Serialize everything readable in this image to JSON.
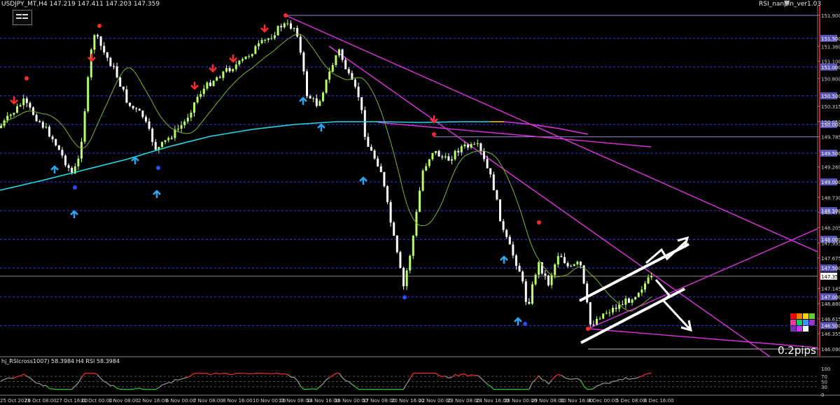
{
  "header": {
    "symbol_info": "USDJPY_MT,H4  147.219 147.411 147.203 147.359",
    "indicator_name": "RSI_nanpin_ver1.03"
  },
  "price_axis": {
    "labels": [
      "151.900",
      "151.360",
      "151.100",
      "150.800",
      "150.315",
      "150.050",
      "149.785",
      "149.260",
      "148.730",
      "148.470",
      "148.205",
      "147.935",
      "147.675",
      "147.145",
      "146.880",
      "146.615",
      "146.355",
      "146.090"
    ],
    "boxed_labels": [
      {
        "text": "151.500",
        "color": "#5a56b8"
      },
      {
        "text": "151.000",
        "color": "#5a56b8"
      },
      {
        "text": "150.500",
        "color": "#5a56b8"
      },
      {
        "text": "150.000",
        "color": "#5a56b8"
      },
      {
        "text": "149.500",
        "color": "#5a56b8"
      },
      {
        "text": "149.000",
        "color": "#5a56b8"
      },
      {
        "text": "148.500",
        "color": "#5a56b8"
      },
      {
        "text": "148.000",
        "color": "#5a56b8"
      },
      {
        "text": "147.500",
        "color": "#5a56b8"
      },
      {
        "text": "147.000",
        "color": "#5a56b8"
      },
      {
        "text": "146.500",
        "color": "#5a56b8"
      }
    ],
    "current_price": "147.359"
  },
  "time_axis": {
    "labels": [
      "25 Oct 2023",
      "26 Oct 08:00",
      "27 Oct 16:00",
      "31 Oct 00:00",
      "1 Nov 08:00",
      "2 Nov 16:00",
      "6 Nov 00:00",
      "7 Nov 08:00",
      "8 Nov 16:00",
      "10 Nov 00:00",
      "13 Nov 08:00",
      "14 Nov 16:00",
      "16 Nov 00:00",
      "17 Nov 08:00",
      "20 Nov 16:00",
      "22 Nov 00:00",
      "23 Nov 08:00",
      "24 Nov 16:00",
      "28 Nov 00:00",
      "29 Nov 08:00",
      "30 Nov 16:00",
      "4 Dec 00:00",
      "5 Dec 08:00",
      "6 Dec 16:00"
    ]
  },
  "annotation": {
    "pips_text": "0.2pips"
  },
  "subwindow": {
    "indicator_label": "hj_RSIcross1007) 58.3984  H4 RSI  58.3984",
    "levels": [
      "100",
      "70",
      "50",
      "30",
      "0"
    ]
  },
  "palette": {
    "colors": [
      "#ff0000",
      "#ff7a00",
      "#ffd500",
      "#66cc33",
      "#ff3399",
      "#00cc66",
      "#3399ff",
      "#9933cc",
      "#7a2fb0",
      "#cc33ff",
      "#ffffff"
    ]
  },
  "colors": {
    "bull": "#b7ff6a",
    "bear": "#ffffff",
    "ma_fast": "#7fb61e",
    "ma_slow": "#24d7e8",
    "trend": "#dd33dd",
    "grid": "#3b3bd0",
    "rsi_hi": "#ff2b2b",
    "rsi_lo": "#2ecc2e",
    "rsi_mid": "#9a9a9a"
  },
  "icons": [
    "up-arrow-signal-icon",
    "down-arrow-signal-icon",
    "chart-shift-icon"
  ]
}
